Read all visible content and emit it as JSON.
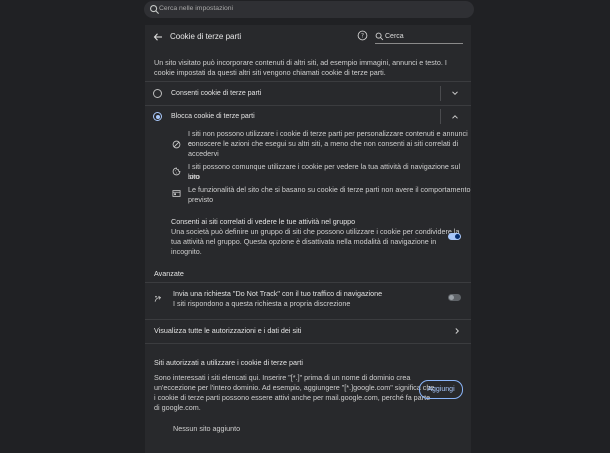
{
  "topbar": {
    "search_placeholder": "Cerca nelle impostazioni"
  },
  "header": {
    "title": "Cookie di terze parti",
    "search_value": "Cerca"
  },
  "intro": "Un sito visitato può incorporare contenuti di altri siti, ad esempio immagini, annunci e testo. I cookie impostati da questi altri siti vengono chiamati cookie di terze parti.",
  "options": [
    {
      "label": "Consenti cookie di terze parti",
      "selected": false
    },
    {
      "label": "Blocca cookie di terze parti",
      "selected": true
    }
  ],
  "details": [
    {
      "icon": "block-icon",
      "line1": "I siti non possono utilizzare i cookie di terze parti per personalizzare contenuti e annunci e",
      "line2": "conoscere le azioni che esegui su altri siti, a meno che non consenti ai siti correlati di",
      "line3": "accedervi"
    },
    {
      "icon": "cookie-icon",
      "line1": "I siti possono comunque utilizzare i cookie per vedere la tua attività di navigazione sul loro",
      "line2": "sito"
    },
    {
      "icon": "web-icon",
      "line1": "Le funzionalità del sito che si basano su cookie di terze parti non avere il comportamento",
      "line2": "previsto"
    }
  ],
  "related_sites": {
    "title": "Consenti ai siti correlati di vedere le tue attività nel gruppo",
    "line1": "Una società può definire un gruppo di siti che possono utilizzare i cookie per condividere la",
    "line2": "tua attività nel gruppo. Questa opzione è disattivata nella modalità di navigazione in",
    "line3": "incognito.",
    "enabled": true
  },
  "advanced": {
    "heading": "Avanzate",
    "dnt_title": "Invia una richiesta \"Do Not Track\" con il tuo traffico di navigazione",
    "dnt_sub": "I siti rispondono a questa richiesta a propria discrezione",
    "dnt_enabled": false
  },
  "view_all": "Visualizza tutte le autorizzazioni e i dati dei siti",
  "allowed": {
    "heading": "Siti autorizzati a utilizzare i cookie di terze parti",
    "line1": "Sono interessati i siti elencati qui. Inserire \"[*.]\" prima di un nome di dominio crea",
    "line2": "un'eccezione per l'intero dominio. Ad esempio, aggiungere \"[*.]google.com\" significa che",
    "line3": "i cookie di terze parti possono essere attivi anche per mail.google.com, perché fa parte",
    "line4": "di google.com.",
    "add_button": "Aggiungi",
    "empty": "Nessun sito aggiunto"
  },
  "colors": {
    "background": "#202124",
    "panel": "#28292c",
    "accent": "#a8c7fa"
  }
}
